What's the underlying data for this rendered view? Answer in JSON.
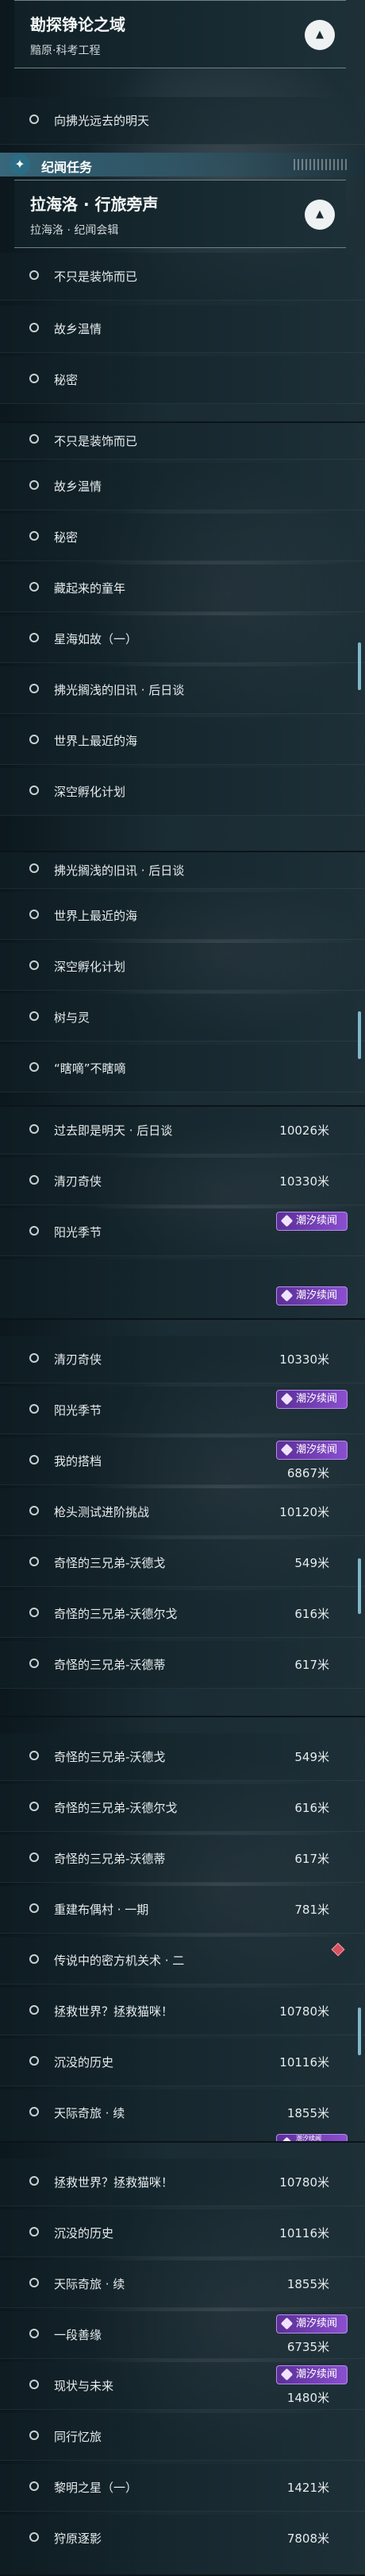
{
  "theme": {
    "accent": "#7fb6c8",
    "badge_color": "#7a45c0",
    "alert_color": "#d8505f"
  },
  "panel1": {
    "header1": {
      "title": "勘探铮论之域",
      "subtitle": "黯原·科考工程",
      "collapse_icon": "▲"
    },
    "quest1": "向拂光远去的明天",
    "section": {
      "icon": "✦",
      "label": "纪闻任务"
    },
    "header2": {
      "title": "拉海洛 · 行旅旁声",
      "subtitle": "拉海洛 · 纪闻会辑",
      "collapse_icon": "▲"
    },
    "quests": [
      "不只是装饰而已",
      "故乡温情",
      "秘密"
    ]
  },
  "panel2": {
    "quests": [
      "不只是装饰而已",
      "故乡温情",
      "秘密",
      "藏起来的童年",
      "星海如故（一）",
      "拂光搁浅的旧讯 · 后日谈",
      "世界上最近的海",
      "深空孵化计划"
    ]
  },
  "panel3": {
    "quests": [
      "拂光搁浅的旧讯 · 后日谈",
      "世界上最近的海",
      "深空孵化计划",
      "树与灵",
      "“瞎嘀”不瞎嘀"
    ]
  },
  "panel4": {
    "rows": [
      {
        "label": "过去即是明天 · 后日谈",
        "dist": "10026米"
      },
      {
        "label": "清刃奇侠",
        "dist": "10330米"
      },
      {
        "label": "阳光季节",
        "badge": "潮汐续闻"
      }
    ],
    "extra_badge": "潮汐续闻"
  },
  "panel5": {
    "rows": [
      {
        "label": "清刃奇侠",
        "dist": "10330米"
      },
      {
        "label": "阳光季节",
        "badge": "潮汐续闻"
      },
      {
        "label": "我的搭档",
        "badge": "潮汐续闻",
        "dist": "6867米"
      },
      {
        "label": "枪头测试进阶挑战",
        "dist": "10120米"
      },
      {
        "label": "奇怪的三兄弟-沃德戈",
        "dist": "549米"
      },
      {
        "label": "奇怪的三兄弟-沃德尔戈",
        "dist": "616米"
      },
      {
        "label": "奇怪的三兄弟-沃德蒂",
        "dist": "617米"
      }
    ]
  },
  "panel6": {
    "rows": [
      {
        "label": "奇怪的三兄弟-沃德戈",
        "dist": "549米"
      },
      {
        "label": "奇怪的三兄弟-沃德尔戈",
        "dist": "616米"
      },
      {
        "label": "奇怪的三兄弟-沃德蒂",
        "dist": "617米"
      },
      {
        "label": "重建布偶村 · 一期",
        "dist": "781米"
      },
      {
        "label": "传说中的密方机关术 · 二",
        "dist": ""
      },
      {
        "label": "拯救世界？拯救猫咪！",
        "dist": "10780米"
      },
      {
        "label": "沉没的历史",
        "dist": "10116米"
      },
      {
        "label": "天际奇旅 · 续",
        "dist": "1855米"
      }
    ],
    "extra_badge": "潮汐续闻"
  },
  "panel7": {
    "rows": [
      {
        "label": "拯救世界？拯救猫咪！",
        "dist": "10780米"
      },
      {
        "label": "沉没的历史",
        "dist": "10116米"
      },
      {
        "label": "天际奇旅 · 续",
        "dist": "1855米"
      },
      {
        "label": "一段善缘",
        "badge": "潮汐续闻",
        "dist": "6735米"
      },
      {
        "label": "现状与未来",
        "badge": "潮汐续闻",
        "dist": "1480米"
      },
      {
        "label": "同行忆旅",
        "dist": ""
      },
      {
        "label": "黎明之星（一）",
        "dist": "1421米"
      },
      {
        "label": "狩原逐影",
        "dist": "7808米"
      }
    ]
  }
}
